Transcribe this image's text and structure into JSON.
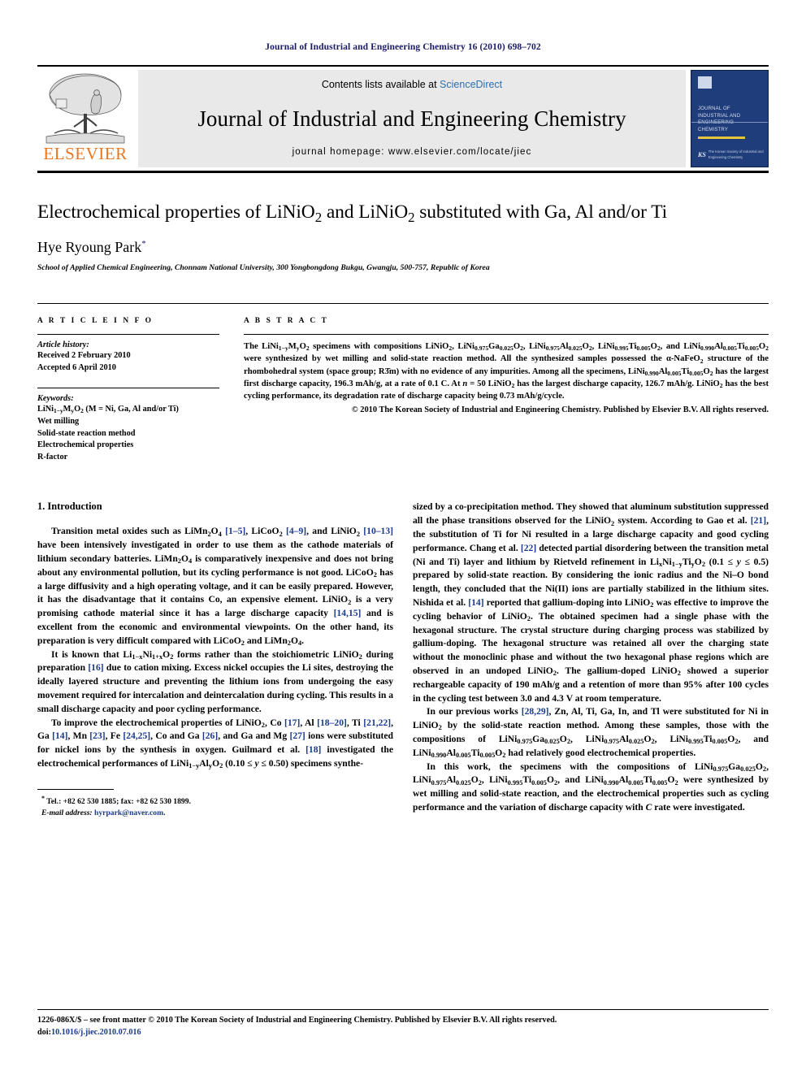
{
  "running_head": "Journal of Industrial and Engineering Chemistry 16 (2010) 698–702",
  "masthead": {
    "contents_prefix": "Contents lists available at ",
    "sciencedirect": "ScienceDirect",
    "journal_title": "Journal of Industrial and Engineering Chemistry",
    "homepage": "journal homepage: www.elsevier.com/locate/jiec",
    "publisher_wordmark": "ELSEVIER",
    "cover_title": "Journal of Industrial and Engineering Chemistry",
    "cover_society": "The Korean Society of Industrial and Engineering Chemistry",
    "accent_orange": "#E87722",
    "link_blue": "#2b6fb5",
    "cover_blue": "#1f3d7a"
  },
  "title_block": {
    "title": "Electrochemical properties of LiNiO2 and LiNiO2 substituted with Ga, Al and/or Ti",
    "author": "Hye Ryoung Park",
    "author_marker": "*",
    "affiliation": "School of Applied Chemical Engineering, Chonnam National University, 300 Yongbongdong Bukgu, Gwangju, 500-757, Republic of Korea"
  },
  "article_info": {
    "heading": "A R T I C L E  I N F O",
    "history_label": "Article history:",
    "history": [
      "Received 2 February 2010",
      "Accepted 6 April 2010"
    ],
    "keywords_label": "Keywords:",
    "keywords": [
      "LiNi1−yMyO2 (M = Ni, Ga, Al and/or Ti)",
      "Wet milling",
      "Solid-state reaction method",
      "Electrochemical properties",
      "R-factor"
    ]
  },
  "abstract": {
    "heading": "A B S T R A C T",
    "copyright": "© 2010 The Korean Society of Industrial and Engineering Chemistry. Published by Elsevier B.V. All rights reserved."
  },
  "body": {
    "section_1_heading": "1. Introduction",
    "footnote": {
      "tel": "Tel.: +82 62 530 1885; fax: +82 62 530 1899.",
      "email_label": "E-mail address:",
      "email": "hyrpark@naver.com"
    }
  },
  "page_footer": {
    "front_matter": "1226-086X/$ – see front matter © 2010 The Korean Society of Industrial and Engineering Chemistry. Published by Elsevier B.V. All rights reserved.",
    "doi_label": "doi:",
    "doi": "10.1016/j.jiec.2010.07.016"
  }
}
